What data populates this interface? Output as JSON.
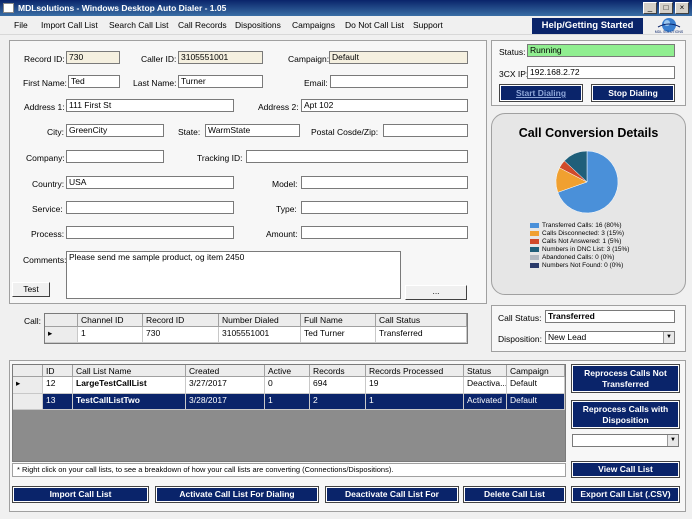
{
  "window": {
    "title": "MDLsolutions - Windows Desktop Auto Dialer - 1.05"
  },
  "menu": {
    "items": [
      "File",
      "Import Call List",
      "Search Call List",
      "Call Records",
      "Dispositions",
      "Campaigns",
      "Do Not Call List",
      "Support"
    ],
    "help_label": "Help/Getting Started",
    "logo_text": "MDL SOLUTIONS"
  },
  "form": {
    "record_id_label": "Record ID:",
    "record_id": "730",
    "caller_id_label": "Caller ID:",
    "caller_id": "3105551001",
    "campaign_label": "Campaign:",
    "campaign": "Default",
    "first_name_label": "First Name:",
    "first_name": "Ted",
    "last_name_label": "Last Name:",
    "last_name": "Turner",
    "email_label": "Email:",
    "email": "",
    "address1_label": "Address 1:",
    "address1": "111 First St",
    "address2_label": "Address 2:",
    "address2": "Apt 102",
    "city_label": "City:",
    "city": "GreenCity",
    "state_label": "State:",
    "state": "WarmState",
    "zip_label": "Postal Cosde/Zip:",
    "zip": "",
    "company_label": "Company:",
    "company": "",
    "tracking_label": "Tracking ID:",
    "tracking": "",
    "country_label": "Country:",
    "country": "USA",
    "model_label": "Model:",
    "model": "",
    "service_label": "Service:",
    "service": "",
    "type_label": "Type:",
    "type": "",
    "process_label": "Process:",
    "process": "",
    "amount_label": "Amount:",
    "amount": "",
    "comments_label": "Comments:",
    "comments": "Please send me sample product, og item 2450",
    "test_button": "Test",
    "ellipsis_button": "...",
    "call_label": "Call:"
  },
  "call_grid": {
    "columns": [
      "Channel ID",
      "Record ID",
      "Number Dialed",
      "Full Name",
      "Call Status"
    ],
    "rows": [
      [
        "1",
        "730",
        "3105551001",
        "Ted  Turner",
        "Transferred"
      ]
    ]
  },
  "status_panel": {
    "status_label": "Status:",
    "status": "Running",
    "ip_label": "3CX IP:",
    "ip": "192.168.2.72",
    "start_button": "Start Dialing",
    "stop_button": "Stop Dialing"
  },
  "chart_data": {
    "type": "pie",
    "title": "Call Conversion Details",
    "slices": [
      {
        "label": "Transferred Calls: 16 (80%)",
        "value": 16,
        "color": "#4a90d9"
      },
      {
        "label": "Calls Disconnected: 3 (15%)",
        "value": 3,
        "color": "#f0a030"
      },
      {
        "label": "Calls Not Answered: 1 (5%)",
        "value": 1,
        "color": "#d04a2a"
      },
      {
        "label": "Numbers in DNC List: 3 (15%)",
        "value": 3,
        "color": "#1f5f7a"
      },
      {
        "label": "Abandoned Calls: 0 (0%)",
        "value": 0,
        "color": "#b0b8c0"
      },
      {
        "label": "Numbers Not Found: 0 (0%)",
        "value": 0,
        "color": "#2a3a6a"
      }
    ]
  },
  "disposition_panel": {
    "call_status_label": "Call Status:",
    "call_status": "Transferred",
    "disposition_label": "Disposition:",
    "disposition": "New Lead"
  },
  "call_lists": {
    "columns": [
      "ID",
      "Call List Name",
      "Created",
      "Active",
      "Records",
      "Records Processed",
      "Status",
      "Campaign"
    ],
    "rows": [
      [
        "12",
        "LargeTestCallList",
        "3/27/2017",
        "0",
        "694",
        "19",
        "Deactiva...",
        "Default"
      ],
      [
        "13",
        "TestCallListTwo",
        "3/28/2017",
        "1",
        "2",
        "1",
        "Activated",
        "Default"
      ]
    ],
    "hint": "* Right click on your call lists, to see a breakdown of how your call lists are converting (Connections/Dispositions)."
  },
  "side_buttons": {
    "reprocess_not_transferred": "Reprocess Calls Not Transferred",
    "reprocess_with_disposition": "Reprocess Calls with Disposition",
    "view_call_list": "View Call List",
    "export_call_list": "Export Call List (.CSV)"
  },
  "bottom_buttons": {
    "import": "Import Call List",
    "activate": "Activate Call List For Dialing",
    "deactivate": "Deactivate Call List For",
    "delete": "Delete Call List"
  },
  "colors": {
    "navy": "#0a246a",
    "running_green": "#90ee90",
    "selected_row": "#0a246a"
  }
}
